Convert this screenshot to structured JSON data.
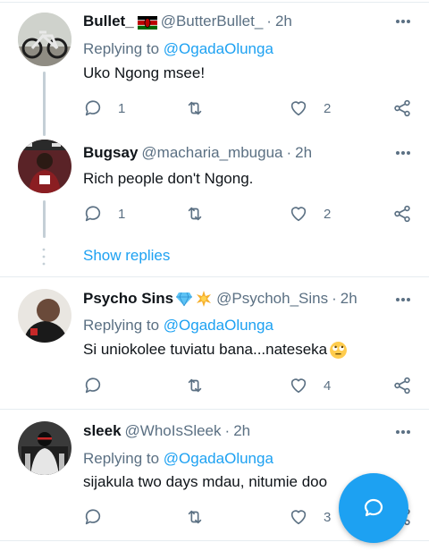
{
  "colors": {
    "accent": "#1da1f2",
    "secondary_text": "#5b7083",
    "primary_text": "#0f1419",
    "divider": "#e6ecf0",
    "thread_line": "#c4cfd6"
  },
  "tweets": [
    {
      "name": "Bullet_",
      "badge": "kenya-flag",
      "handle": "@ButterBullet_",
      "sep": "·",
      "time": "2h",
      "replying_prefix": "Replying to",
      "replying_to": "@OgadaOlunga",
      "text": "Uko Ngong msee!",
      "replies": "1",
      "retweets": "",
      "likes": "2"
    },
    {
      "name": "Bugsay",
      "handle": "@macharia_mbugua",
      "sep": "·",
      "time": "2h",
      "text": "Rich people don't  Ngong.",
      "replies": "1",
      "retweets": "",
      "likes": "2"
    },
    {
      "name": "Psycho Sins",
      "badges": [
        "gem-emoji",
        "star-emoji"
      ],
      "handle": "@Psychoh_Sins",
      "sep": "·",
      "time": "2h",
      "replying_prefix": "Replying to",
      "replying_to": "@OgadaOlunga",
      "text": "Si uniokolee tuviatu bana...nateseka",
      "text_emoji": "eye-roll-emoji",
      "replies": "",
      "retweets": "",
      "likes": "4"
    },
    {
      "name": "sleek",
      "handle": "@WhoIsSleek",
      "sep": "·",
      "time": "2h",
      "replying_prefix": "Replying to",
      "replying_to": "@OgadaOlunga",
      "text": "sijakula two days mdau, nitumie doo",
      "replies": "",
      "retweets": "",
      "likes": "3"
    }
  ],
  "show_replies": "Show replies",
  "fab_icon": "new-reply-icon"
}
